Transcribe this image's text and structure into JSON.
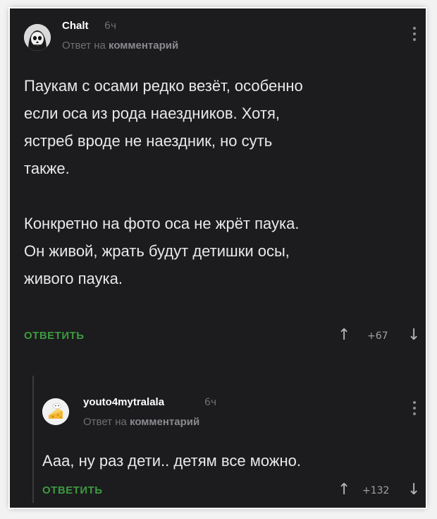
{
  "comments": [
    {
      "author": "Chalt",
      "time": "6ч",
      "reply_prefix": "Ответ на",
      "reply_target": "комментарий",
      "text": "Паукам с осами редко везёт, особенно\nесли оса из рода наездников. Хотя,\nястреб вроде не наездник, но суть\nтакже.\n\nКонкретно на фото оса не жрёт паука.\nОн живой, жрать будут детишки осы,\nживого паука.",
      "reply_label": "ОТВЕТИТЬ",
      "rating": "+67",
      "avatar_icon": "skull-avatar-icon"
    },
    {
      "author": "youto4mytralala",
      "time": "6ч",
      "reply_prefix": "Ответ на",
      "reply_target": "комментарий",
      "text": "Ааа, ну раз дети.. детям все можно.",
      "reply_label": "ОТВЕТИТЬ",
      "rating": "+132",
      "avatar_icon": "cheese-avatar-icon"
    }
  ],
  "colors": {
    "background": "#1c1c1e",
    "accent_green": "#3d9a3f",
    "text": "#e9e9ea",
    "muted": "#6f6f74"
  },
  "icons": {
    "upvote": "↑",
    "downvote": "↓",
    "menu": "more-vertical-icon"
  }
}
